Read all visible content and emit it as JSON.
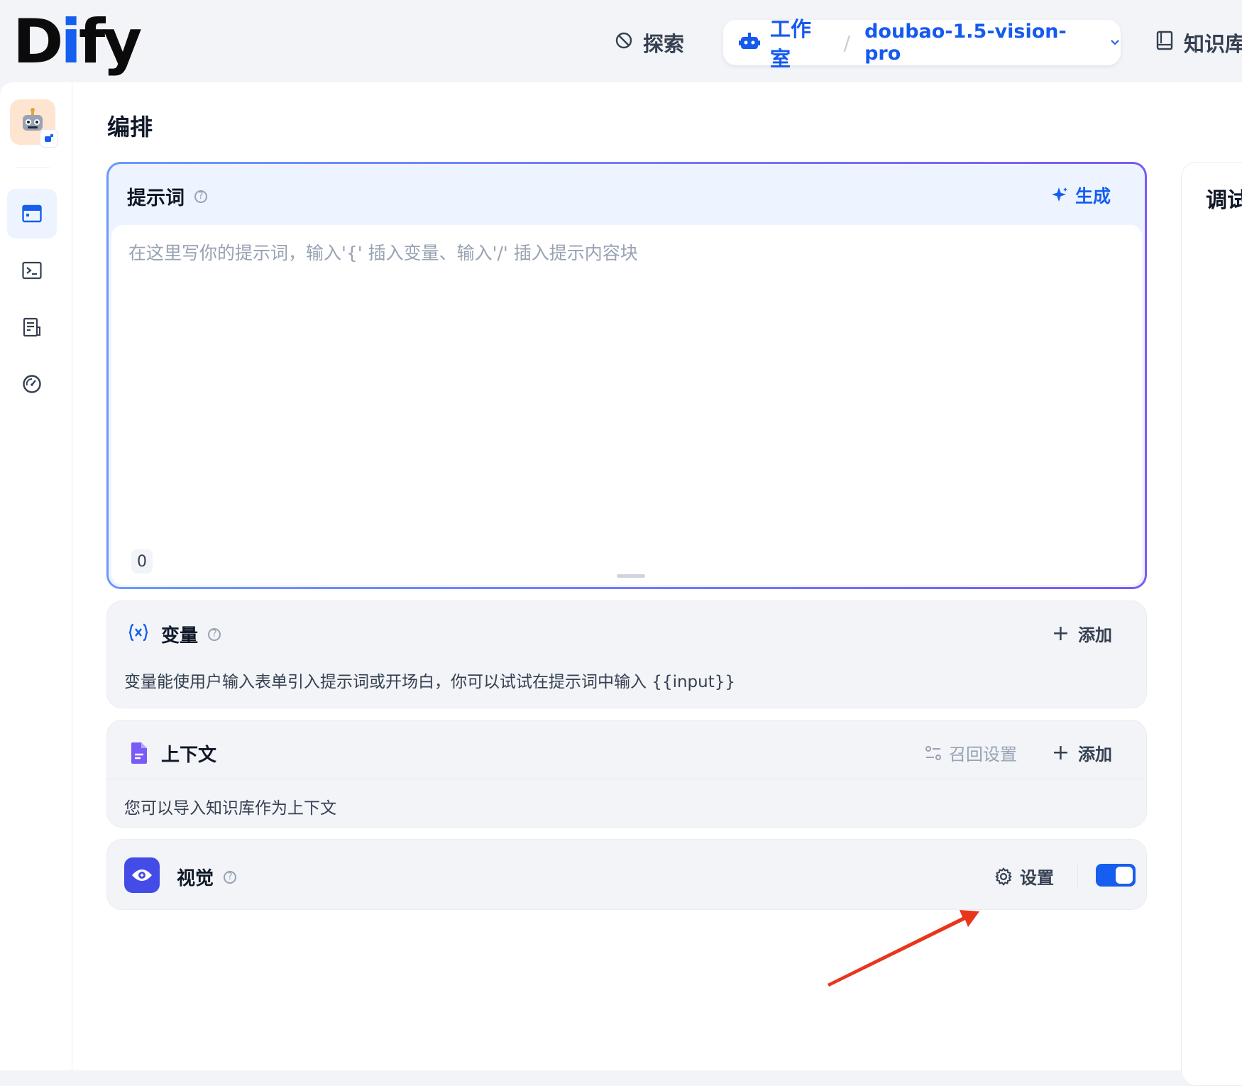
{
  "header": {
    "logo_part1": "D",
    "logo_part2": "i",
    "logo_part3": "fy",
    "nav_explore": "探索",
    "nav_studio": "工作室",
    "separator": "/",
    "current_app": "doubao-1.5-vision-pro",
    "nav_knowledge": "知识库"
  },
  "page": {
    "title": "编排"
  },
  "prompt": {
    "title": "提示词",
    "generate_label": "生成",
    "placeholder": "在这里写你的提示词，输入'{' 插入变量、输入'/' 插入提示内容块",
    "char_count": "0"
  },
  "variables": {
    "title": "变量",
    "add_label": "添加",
    "description": "变量能使用户输入表单引入提示词或开场白，你可以试试在提示词中输入 {{input}}"
  },
  "context": {
    "title": "上下文",
    "recall_label": "召回设置",
    "add_label": "添加",
    "description": "您可以导入知识库作为上下文"
  },
  "vision": {
    "title": "视觉",
    "settings_label": "设置",
    "enabled": true
  },
  "debug": {
    "title": "调试"
  },
  "colors": {
    "accent": "#155eef",
    "vision_icon": "#444ce7",
    "annotation_arrow": "#e8361e"
  },
  "icons": [
    "explore-icon",
    "robot-icon",
    "chevron-down-icon",
    "book-icon",
    "orchestrate-icon",
    "terminal-icon",
    "logs-icon",
    "monitor-icon",
    "sparkle-icon",
    "variable-icon",
    "document-icon",
    "recall-settings-icon",
    "eye-icon",
    "gear-icon",
    "question-icon",
    "plus-icon"
  ]
}
